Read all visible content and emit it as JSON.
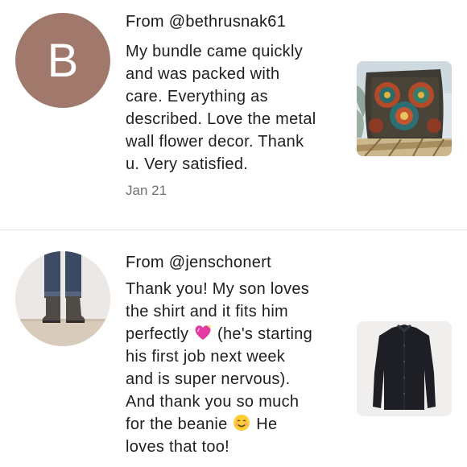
{
  "reviews": [
    {
      "avatar_letter": "B",
      "from": "From @bethrusnak61",
      "lines": [
        "My bundle came quickly",
        "and was packed with",
        "care. Everything as",
        "described. Love the metal",
        "wall flower decor. Thank",
        "u. Very satisfied."
      ],
      "date": "Jan 21",
      "avatar_color": "#a0796c"
    },
    {
      "from": "From @jenschonert",
      "lines": [
        "Thank you! My son loves",
        "the shirt and it fits him",
        "perfectly",
        " (he's starting",
        "his first job next week",
        "and is super nervous).",
        "And thank you so much",
        "for the beanie",
        " He",
        "loves that too!"
      ]
    }
  ]
}
